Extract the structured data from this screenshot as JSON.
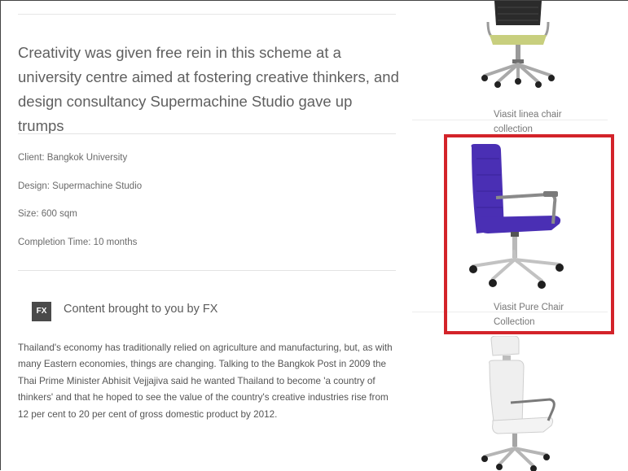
{
  "intro": "Creativity was given free rein in this scheme at a university centre aimed at fostering creative thinkers, and design consultancy Supermachine Studio gave up trumps",
  "facts": [
    "Client: Bangkok University",
    "Design: Supermachine Studio",
    "Size: 600 sqm",
    "Completion Time: 10 months"
  ],
  "sponsor": {
    "logo_text": "FX",
    "text": "Content brought to you by FX"
  },
  "body": "Thailand's economy has traditionally relied on agriculture and manufacturing, but, as with many Eastern economies, things are changing. Talking to the Bangkok Post in 2009 the Thai Prime Minister Abhisit Vejjajiva said he wanted Thailand to become 'a country of thinkers' and that he hoped to see the value of the country's creative industries rise from 12 per cent to 20 per cent of gross domestic product by 2012.",
  "sidebar": {
    "products": [
      {
        "label": "Viasit linea chair collection",
        "seat_color": "#c8cf7e"
      },
      {
        "label": "Viasit Pure Chair Collection",
        "seat_color": "#4a2fb4"
      },
      {
        "label": "",
        "seat_color": "#efefef"
      }
    ],
    "highlight_color": "#d3232a"
  }
}
